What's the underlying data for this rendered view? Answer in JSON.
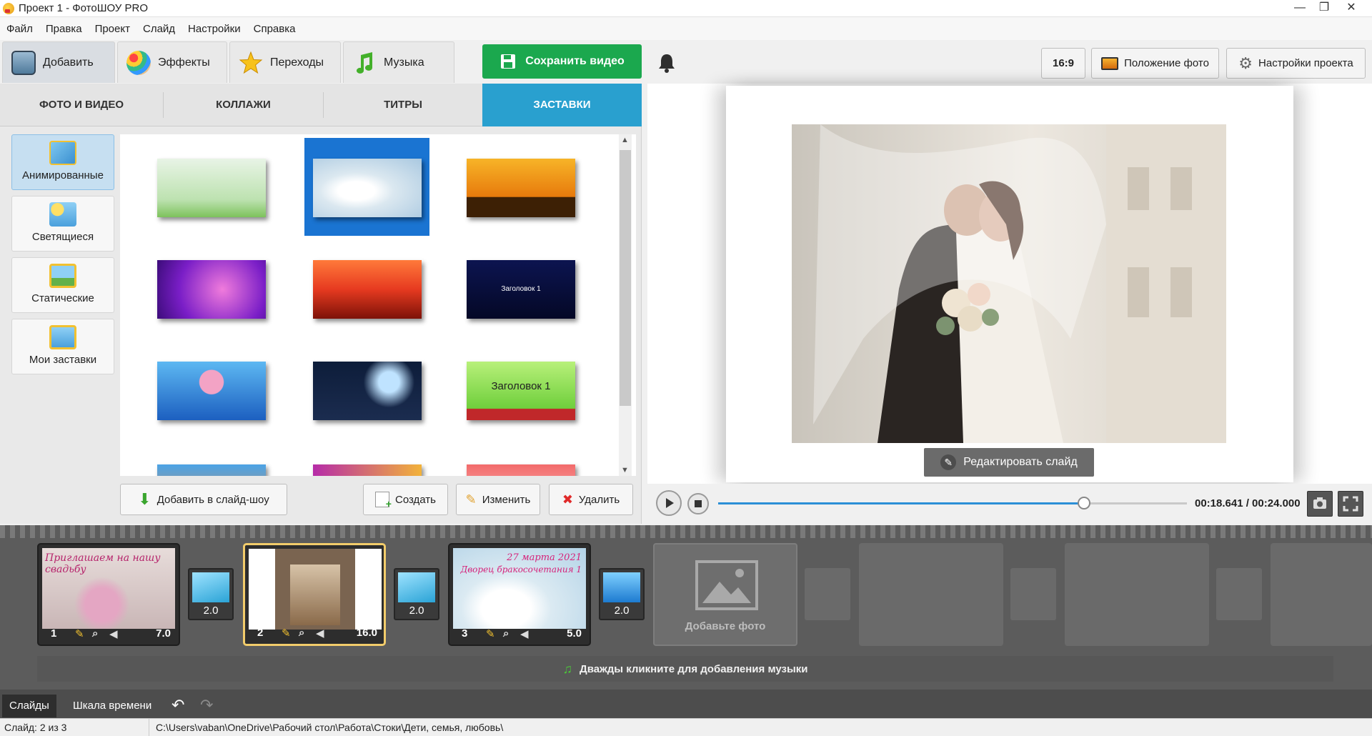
{
  "window": {
    "title": "Проект 1 - ФотоШОУ PRO",
    "minimize": "—",
    "maximize": "❐",
    "close": "✕"
  },
  "menu": [
    "Файл",
    "Правка",
    "Проект",
    "Слайд",
    "Настройки",
    "Справка"
  ],
  "main_tabs": [
    {
      "label": "Добавить",
      "icon": "camera-icon"
    },
    {
      "label": "Эффекты",
      "icon": "palette-icon"
    },
    {
      "label": "Переходы",
      "icon": "star-icon"
    },
    {
      "label": "Музыка",
      "icon": "music-note-icon"
    }
  ],
  "save_button": "Сохранить видео",
  "toolbar_right": {
    "ratio": "16:9",
    "photo_position": "Положение фото",
    "project_settings": "Настройки проекта"
  },
  "sub_tabs": [
    "ФОТО И ВИДЕО",
    "КОЛЛАЖИ",
    "ТИТРЫ",
    "ЗАСТАВКИ"
  ],
  "categories": [
    "Анимированные",
    "Светящиеся",
    "Статические",
    "Мои заставки"
  ],
  "thumb_texts": {
    "t6": "Заголовок 1",
    "t9": "Заголовок 1"
  },
  "panel_buttons": {
    "add": "Добавить в слайд-шоу",
    "create": "Создать",
    "edit": "Изменить",
    "delete": "Удалить"
  },
  "preview": {
    "edit_slide": "Редактировать слайд",
    "time": "00:18.641 / 00:24.000",
    "progress": 0.78
  },
  "slides": [
    {
      "num": "1",
      "duration": "7.0",
      "caption": "Приглашаем на нашу свадьбу"
    },
    {
      "num": "2",
      "duration": "16.0",
      "caption": ""
    },
    {
      "num": "3",
      "duration": "5.0",
      "caption": "27 марта 2021",
      "caption2": "Дворец бракосочетания 1"
    }
  ],
  "transitions": [
    "2.0",
    "2.0",
    "2.0"
  ],
  "add_photo": "Добавьте фото",
  "music_hint": "Дважды кликните для добавления музыки",
  "bottom_tabs": [
    "Слайды",
    "Шкала времени"
  ],
  "status": {
    "slide": "Слайд: 2 из 3",
    "path": "C:\\Users\\vaban\\OneDrive\\Рабочий стол\\Работа\\Стоки\\Дети, семья, любовь\\"
  }
}
